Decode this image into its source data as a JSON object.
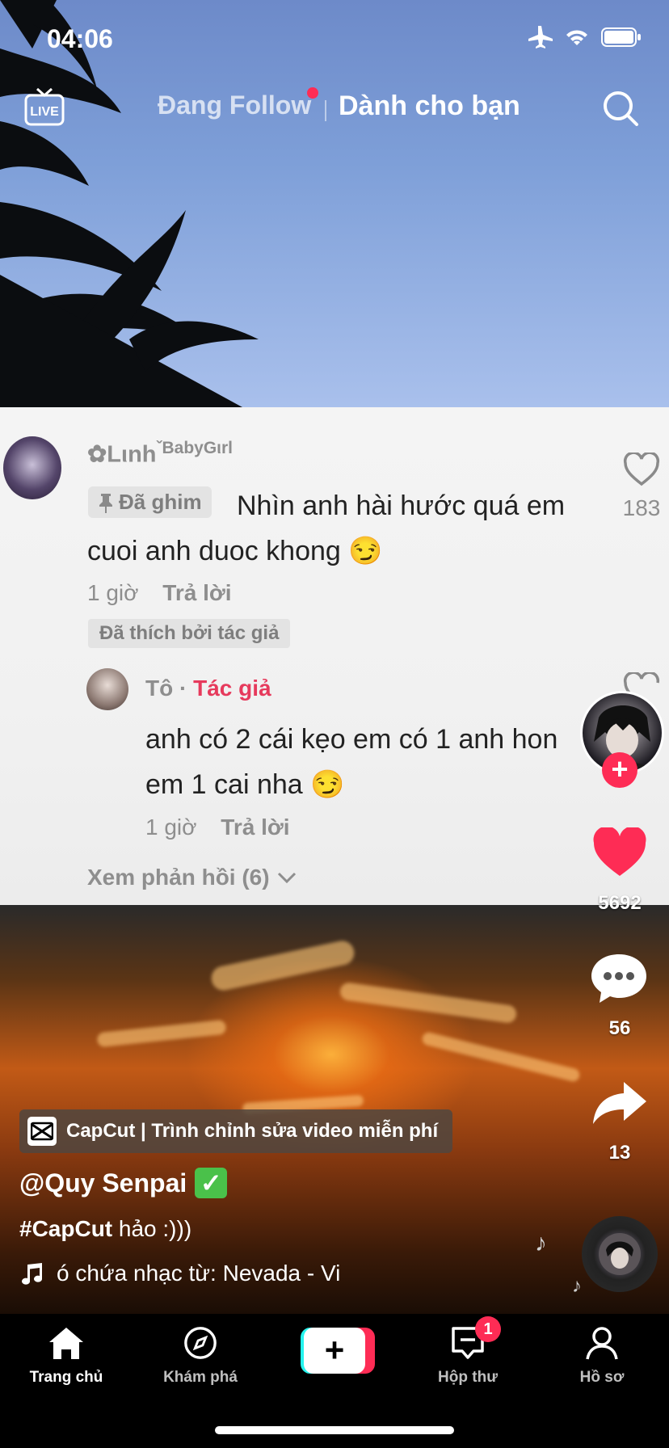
{
  "status_bar": {
    "time": "04:06"
  },
  "top_nav": {
    "following": "Đang Follow",
    "for_you": "Dành cho bạn",
    "live_label": "LIVE"
  },
  "comment": {
    "username": "✿Lιnh",
    "username_suffix": "ˇBabyGιrl",
    "pinned_label": "Đã ghim",
    "text": "Nhìn anh hài hước quá em cuoi anh duoc khong 😏",
    "time": "1 giờ",
    "reply": "Trả lời",
    "liked_by_author": "Đã thích bởi tác giả",
    "likes": "183"
  },
  "reply": {
    "username": "Tô",
    "separator": "·",
    "author_tag": "Tác giả",
    "text": "anh có 2 cái kẹo em có 1 anh hon em 1 cai nha 😏",
    "time": "1 giờ",
    "reply": "Trả lời"
  },
  "view_replies": "Xem phản hồi (6)",
  "right_rail": {
    "follow_plus": "+",
    "likes": "5692",
    "comments": "56",
    "shares": "13"
  },
  "video": {
    "capcut_chip": "CapCut | Trình chỉnh sửa video miễn phí",
    "handle": "@Quy Senpai",
    "verified": "✓",
    "hashtag": "#CapCut",
    "caption_rest": " hảo :)))",
    "music": "ó chứa nhạc từ: Nevada - Vi"
  },
  "tabs": {
    "home": "Trang chủ",
    "discover": "Khám phá",
    "create": "+",
    "inbox": "Hộp thư",
    "inbox_badge": "1",
    "profile": "Hồ sơ"
  }
}
